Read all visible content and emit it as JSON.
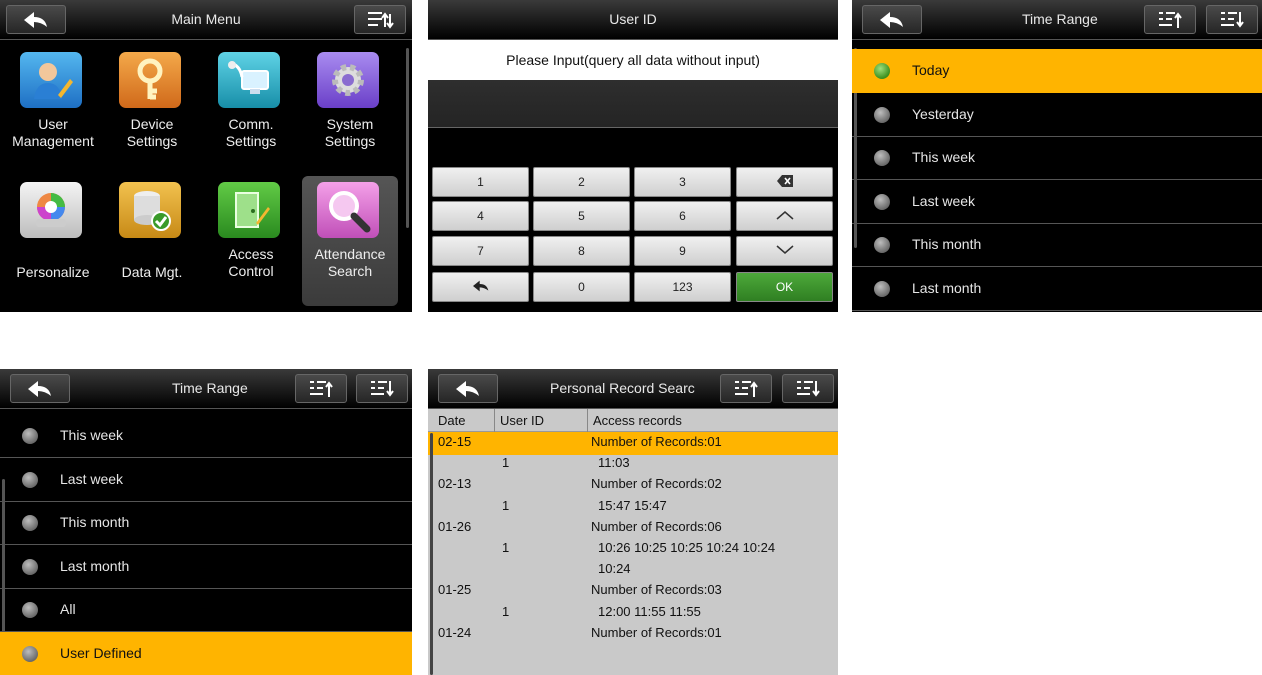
{
  "main_menu": {
    "title": "Main Menu",
    "items": [
      {
        "label1": "User",
        "label2": "Management",
        "icon": "user-management-icon"
      },
      {
        "label1": "Device",
        "label2": "Settings",
        "icon": "key-icon"
      },
      {
        "label1": "Comm.",
        "label2": "Settings",
        "icon": "network-computer-icon"
      },
      {
        "label1": "System",
        "label2": "Settings",
        "icon": "gear-icon"
      },
      {
        "label1": "",
        "label2": "Personalize",
        "icon": "color-wheel-icon"
      },
      {
        "label1": "",
        "label2": "Data Mgt.",
        "icon": "database-icon"
      },
      {
        "label1": "Access",
        "label2": "Control",
        "icon": "door-icon"
      },
      {
        "label1": "Attendance",
        "label2": "Search",
        "icon": "magnifier-icon"
      }
    ]
  },
  "user_id": {
    "title": "User ID",
    "prompt": "Please Input(query all data without input)",
    "keys": [
      "1",
      "2",
      "3",
      "",
      "4",
      "5",
      "6",
      "",
      "7",
      "8",
      "9",
      "",
      "",
      "0",
      "123",
      "OK"
    ]
  },
  "time_range_1": {
    "title": "Time Range",
    "items": [
      "Today",
      "Yesterday",
      "This week",
      "Last week",
      "This month",
      "Last month"
    ]
  },
  "time_range_2": {
    "title": "Time Range",
    "items": [
      "This week",
      "Last week",
      "This month",
      "Last month",
      "All",
      "User Defined"
    ]
  },
  "records": {
    "title": "Personal Record Searc",
    "headers": [
      "Date",
      "User ID",
      "Access records"
    ],
    "rows": [
      [
        "02-15",
        "",
        "Number of Records:01"
      ],
      [
        "",
        "1",
        "11:03"
      ],
      [
        "02-13",
        "",
        "Number of Records:02"
      ],
      [
        "",
        "1",
        "15:47 15:47"
      ],
      [
        "01-26",
        "",
        "Number of Records:06"
      ],
      [
        "",
        "1",
        "10:26 10:25 10:25 10:24 10:24"
      ],
      [
        "",
        "",
        "10:24"
      ],
      [
        "01-25",
        "",
        "Number of Records:03"
      ],
      [
        "",
        "1",
        "12:00 11:55 11:55"
      ],
      [
        "01-24",
        "",
        "Number of Records:01"
      ]
    ]
  },
  "colors": {
    "accent": "#ffb400",
    "ok": "#3f9a2e"
  }
}
